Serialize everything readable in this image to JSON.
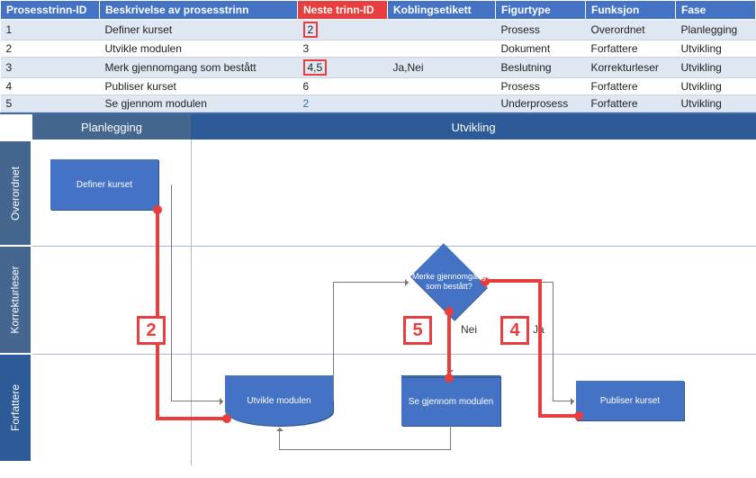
{
  "table": {
    "headers": {
      "c0": "Prosesstrinn-ID",
      "c1": "Beskrivelse av prosesstrinn",
      "c2": "Neste trinn-ID",
      "c3": "Koblingsetikett",
      "c4": "Figurtype",
      "c5": "Funksjon",
      "c6": "Fase"
    },
    "rows": [
      {
        "id": "1",
        "desc": "Definer kurset",
        "next": "2",
        "next_boxed": true,
        "label": "",
        "shape": "Prosess",
        "role": "Overordnet",
        "phase": "Planlegging"
      },
      {
        "id": "2",
        "desc": "Utvikle modulen",
        "next": "3",
        "next_boxed": false,
        "label": "",
        "shape": "Dokument",
        "role": "Forfattere",
        "phase": "Utvikling"
      },
      {
        "id": "3",
        "desc": "Merk gjennomgang som bestått",
        "next": "4,5",
        "next_boxed": true,
        "label": "Ja,Nei",
        "shape": "Beslutning",
        "role": "Korrekturleser",
        "phase": "Utvikling"
      },
      {
        "id": "4",
        "desc": "Publiser kurset",
        "next": "6",
        "next_boxed": false,
        "label": "",
        "shape": "Prosess",
        "role": "Forfattere",
        "phase": "Utvikling"
      },
      {
        "id": "5",
        "desc": "Se gjennom modulen",
        "next": "2",
        "next_boxed": false,
        "next_link": true,
        "label": "",
        "shape": "Underprosess",
        "role": "Forfattere",
        "phase": "Utvikling"
      }
    ]
  },
  "diagram": {
    "phases": {
      "p1": "Planlegging",
      "p2": "Utvikling"
    },
    "lanes": {
      "l1": "Overordnet",
      "l2": "Korrekturleser",
      "l3": "Forfattere"
    },
    "shapes": {
      "define": "Definer kurset",
      "develop": "Utvikle modulen",
      "decision": "Merke gjennomgang som bestått?",
      "review": "Se gjennom modulen",
      "publish": "Publiser kurset"
    },
    "edge_labels": {
      "no": "Nei",
      "yes": "Ja"
    },
    "callouts": {
      "a": "2",
      "b": "5",
      "c": "4"
    }
  }
}
